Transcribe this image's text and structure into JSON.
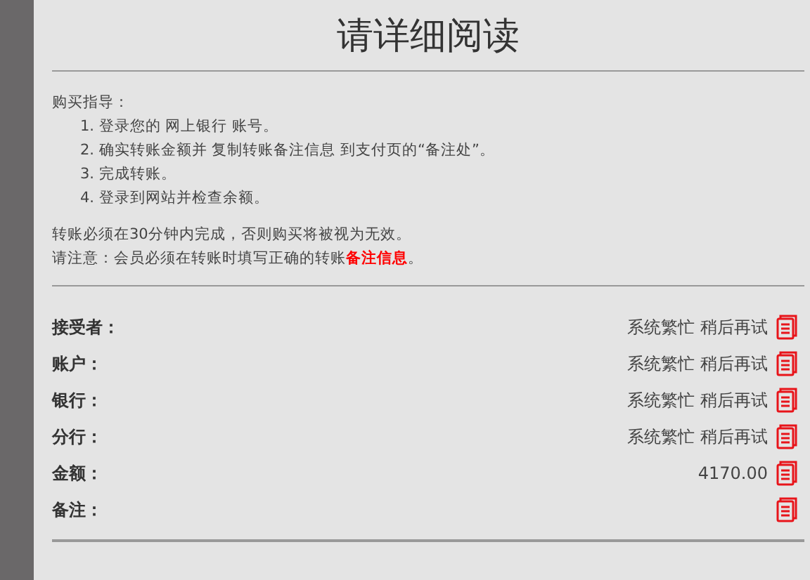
{
  "title": "请详细阅读",
  "guide": {
    "heading": "购买指导：",
    "steps": [
      "1. 登录您的 网上银行 账号。",
      "2. 确实转账金额并 复制转账备注信息 到支付页的“备注处”。",
      "3. 完成转账。",
      "4. 登录到网站并检查余额。"
    ]
  },
  "notes": [
    "转账必须在30分钟内完成，否则购买将被视为无效。",
    "请注意：会员必须在转账时填写正确的转账**备注信息**。"
  ],
  "fields": [
    {
      "label": "接受者：",
      "value": "系统繁忙 稍后再试"
    },
    {
      "label": "账户：",
      "value": "系统繁忙 稍后再试"
    },
    {
      "label": "银行：",
      "value": "系统繁忙 稍后再试"
    },
    {
      "label": "分行：",
      "value": "系统繁忙 稍后再试"
    },
    {
      "label": "金额：",
      "value": "4170.00"
    },
    {
      "label": "备注："
    }
  ]
}
